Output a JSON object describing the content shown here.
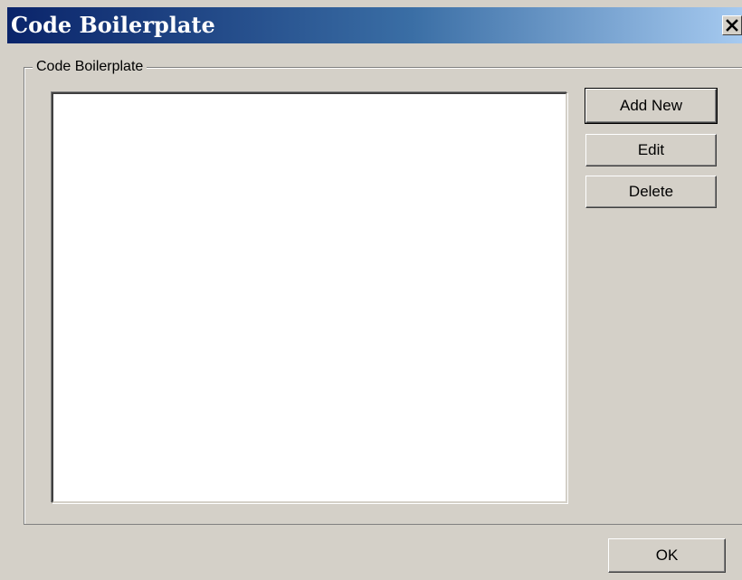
{
  "window": {
    "title": "Code Boilerplate",
    "close_icon": "close-icon"
  },
  "group": {
    "label": "Code Boilerplate"
  },
  "list": {
    "items": []
  },
  "buttons": {
    "add_new": "Add New",
    "edit": "Edit",
    "delete": "Delete",
    "ok": "OK"
  },
  "colors": {
    "face": "#d4d0c8",
    "title_start": "#0a246a",
    "title_end": "#a6caf0",
    "list_bg": "#ffffff"
  }
}
